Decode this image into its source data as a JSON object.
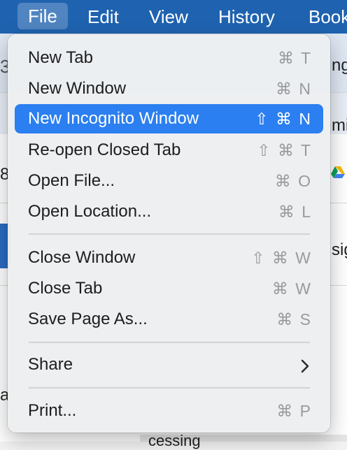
{
  "menubar": {
    "items": [
      "File",
      "Edit",
      "View",
      "History",
      "Book"
    ]
  },
  "background_fragments": [
    "3",
    "ng",
    "mi",
    "8",
    "sig",
    "a",
    "cessing"
  ],
  "file_menu": {
    "items": [
      {
        "label": "New Tab",
        "shortcut": "⌘ T"
      },
      {
        "label": "New Window",
        "shortcut": "⌘ N"
      },
      {
        "label": "New Incognito Window",
        "shortcut": "⇧ ⌘ N",
        "highlighted": true
      },
      {
        "label": "Re-open Closed Tab",
        "shortcut": "⇧ ⌘ T"
      },
      {
        "label": "Open File...",
        "shortcut": "⌘ O"
      },
      {
        "label": "Open Location...",
        "shortcut": "⌘ L"
      },
      {
        "label": "Close Window",
        "shortcut": "⇧ ⌘ W"
      },
      {
        "label": "Close Tab",
        "shortcut": "⌘ W"
      },
      {
        "label": "Save Page As...",
        "shortcut": "⌘ S"
      },
      {
        "label": "Share",
        "submenu_icon": "chevron-right-icon"
      },
      {
        "label": "Print...",
        "shortcut": "⌘ P"
      }
    ]
  },
  "colors": {
    "menubar": "#1f63b0",
    "highlight": "#2b7ff0"
  }
}
